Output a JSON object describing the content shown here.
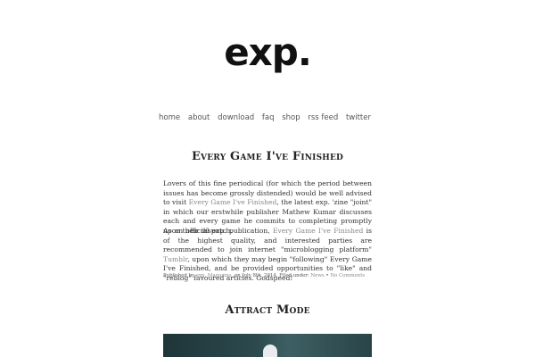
{
  "site": {
    "logo": "exp."
  },
  "nav": {
    "items": [
      "home",
      "about",
      "download",
      "faq",
      "shop",
      "rss feed",
      "twitter"
    ]
  },
  "post1": {
    "title": "Every Game I've Finished",
    "para1": {
      "a": "Lovers of this fine periodical (for which the period between issues has become grossly distended) would be well advised to visit ",
      "link": "Every Game I've Finished",
      "b": ", the latest exp. 'zine \"joint\" in which our erstwhile publisher Mathew Kumar discusses each and every game he commits to completing promptly upon their dispatch."
    },
    "para2": {
      "a": "As an official exp. publication, ",
      "link1": "Every Game I've Finished",
      "b": " is of the highest quality, and interested parties are recommended to join internet \"microblogging platform\" ",
      "link2": "Tumblr",
      "c": ", upon which they may begin \"following\" Every Game I've Finished, and be provided opportunities to \"like\" and \"reblog\" favoured articles. Godspeed!"
    },
    "meta": {
      "published_by": "Published by ",
      "author": "exp. Magazine",
      "date": ", on July 8th, 2014. Filed under: ",
      "category": "News",
      "sep": " • ",
      "comments": "No Comments"
    }
  },
  "post2": {
    "title": "Attract Mode"
  },
  "colors": {
    "text": "#333333",
    "link": "#8a8a8a",
    "hero_dark": "#1f3538"
  }
}
